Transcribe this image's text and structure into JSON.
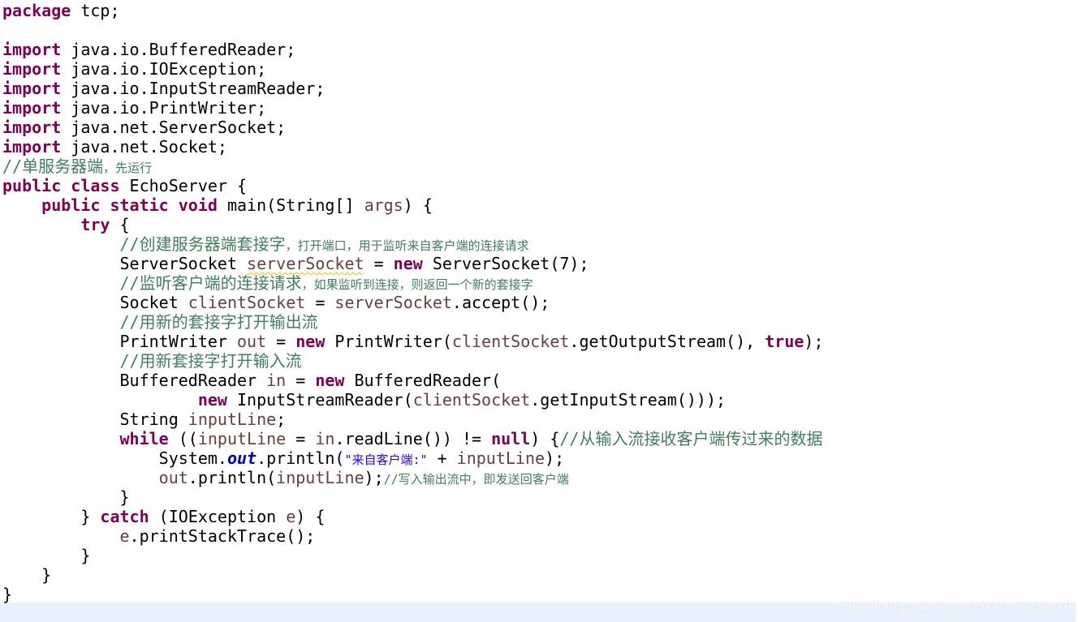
{
  "editor": {
    "colors": {
      "keyword": "#7F0055",
      "comment": "#3F7F5F",
      "local_variable": "#6A3E3E",
      "string": "#2A00FF",
      "field": "#0000C0",
      "current_line": "#E8F2FE"
    },
    "lines": [
      [
        [
          "k",
          "package"
        ],
        [
          "p",
          " tcp;"
        ]
      ],
      [],
      [
        [
          "k",
          "import"
        ],
        [
          "p",
          " java.io.BufferedReader;"
        ]
      ],
      [
        [
          "k",
          "import"
        ],
        [
          "p",
          " java.io.IOException;"
        ]
      ],
      [
        [
          "k",
          "import"
        ],
        [
          "p",
          " java.io.InputStreamReader;"
        ]
      ],
      [
        [
          "k",
          "import"
        ],
        [
          "p",
          " java.io.PrintWriter;"
        ]
      ],
      [
        [
          "k",
          "import"
        ],
        [
          "p",
          " java.net.ServerSocket;"
        ]
      ],
      [
        [
          "k",
          "import"
        ],
        [
          "p",
          " java.net.Socket;"
        ]
      ],
      [
        [
          "c",
          "//单服务器端"
        ],
        [
          "cs",
          "，先运行"
        ]
      ],
      [
        [
          "k",
          "public"
        ],
        [
          "p",
          " "
        ],
        [
          "k",
          "class"
        ],
        [
          "p",
          " EchoServer {"
        ]
      ],
      [
        [
          "p",
          "    "
        ],
        [
          "k",
          "public"
        ],
        [
          "p",
          " "
        ],
        [
          "k",
          "static"
        ],
        [
          "p",
          " "
        ],
        [
          "k",
          "void"
        ],
        [
          "p",
          " main(String[] "
        ],
        [
          "v",
          "args"
        ],
        [
          "p",
          ") {"
        ]
      ],
      [
        [
          "p",
          "        "
        ],
        [
          "k",
          "try"
        ],
        [
          "p",
          " {"
        ]
      ],
      [
        [
          "p",
          "            "
        ],
        [
          "c",
          "//创建服务器端套接字"
        ],
        [
          "cs",
          "，打开端口，用于监听来自客户端的连接请求"
        ]
      ],
      [
        [
          "p",
          "            ServerSocket "
        ],
        [
          "vw",
          "serverSocket"
        ],
        [
          "p",
          " = "
        ],
        [
          "k",
          "new"
        ],
        [
          "p",
          " ServerSocket(7);"
        ]
      ],
      [
        [
          "p",
          "            "
        ],
        [
          "c",
          "//监听客户端的连接请求"
        ],
        [
          "cs",
          "，如果监听到连接，则返回一个新的套接字"
        ]
      ],
      [
        [
          "p",
          "            Socket "
        ],
        [
          "v",
          "clientSocket"
        ],
        [
          "p",
          " = "
        ],
        [
          "v",
          "serverSocket"
        ],
        [
          "p",
          ".accept();"
        ]
      ],
      [
        [
          "p",
          "            "
        ],
        [
          "c",
          "//用新的套接字打开输出流"
        ]
      ],
      [
        [
          "p",
          "            PrintWriter "
        ],
        [
          "v",
          "out"
        ],
        [
          "p",
          " = "
        ],
        [
          "k",
          "new"
        ],
        [
          "p",
          " PrintWriter("
        ],
        [
          "v",
          "clientSocket"
        ],
        [
          "p",
          ".getOutputStream(), "
        ],
        [
          "k",
          "true"
        ],
        [
          "p",
          ");"
        ]
      ],
      [
        [
          "p",
          "            "
        ],
        [
          "c",
          "//用新套接字打开输入流"
        ]
      ],
      [
        [
          "p",
          "            BufferedReader "
        ],
        [
          "v",
          "in"
        ],
        [
          "p",
          " = "
        ],
        [
          "k",
          "new"
        ],
        [
          "p",
          " BufferedReader("
        ]
      ],
      [
        [
          "p",
          "                    "
        ],
        [
          "k",
          "new"
        ],
        [
          "p",
          " InputStreamReader("
        ],
        [
          "v",
          "clientSocket"
        ],
        [
          "p",
          ".getInputStream()));"
        ]
      ],
      [
        [
          "p",
          "            String "
        ],
        [
          "v",
          "inputLine"
        ],
        [
          "p",
          ";"
        ]
      ],
      [
        [
          "p",
          "            "
        ],
        [
          "k",
          "while"
        ],
        [
          "p",
          " (("
        ],
        [
          "v",
          "inputLine"
        ],
        [
          "p",
          " = "
        ],
        [
          "v",
          "in"
        ],
        [
          "p",
          ".readLine()) != "
        ],
        [
          "k",
          "null"
        ],
        [
          "p",
          ") {"
        ],
        [
          "c",
          "//从输入流接收客户端传过来的数据"
        ]
      ],
      [
        [
          "p",
          "                System."
        ],
        [
          "f",
          "out"
        ],
        [
          "p",
          ".println("
        ],
        [
          "ss",
          "\"来自客户端:\""
        ],
        [
          "p",
          " + "
        ],
        [
          "v",
          "inputLine"
        ],
        [
          "p",
          ");"
        ]
      ],
      [
        [
          "p",
          "                "
        ],
        [
          "v",
          "out"
        ],
        [
          "p",
          ".println("
        ],
        [
          "v",
          "inputLine"
        ],
        [
          "p",
          ");"
        ],
        [
          "cs",
          "//写入输出流中，即发送回客户端"
        ]
      ],
      [
        [
          "p",
          "            }"
        ]
      ],
      [
        [
          "p",
          "        } "
        ],
        [
          "k",
          "catch"
        ],
        [
          "p",
          " (IOException "
        ],
        [
          "v",
          "e"
        ],
        [
          "p",
          ") {"
        ]
      ],
      [
        [
          "p",
          "            "
        ],
        [
          "v",
          "e"
        ],
        [
          "p",
          ".printStackTrace();"
        ]
      ],
      [
        [
          "p",
          "        }"
        ]
      ],
      [
        [
          "p",
          "    }"
        ]
      ],
      [
        [
          "p",
          "}"
        ]
      ]
    ]
  },
  "watermark": "https://blog.csdn.net/weixin_43233219"
}
